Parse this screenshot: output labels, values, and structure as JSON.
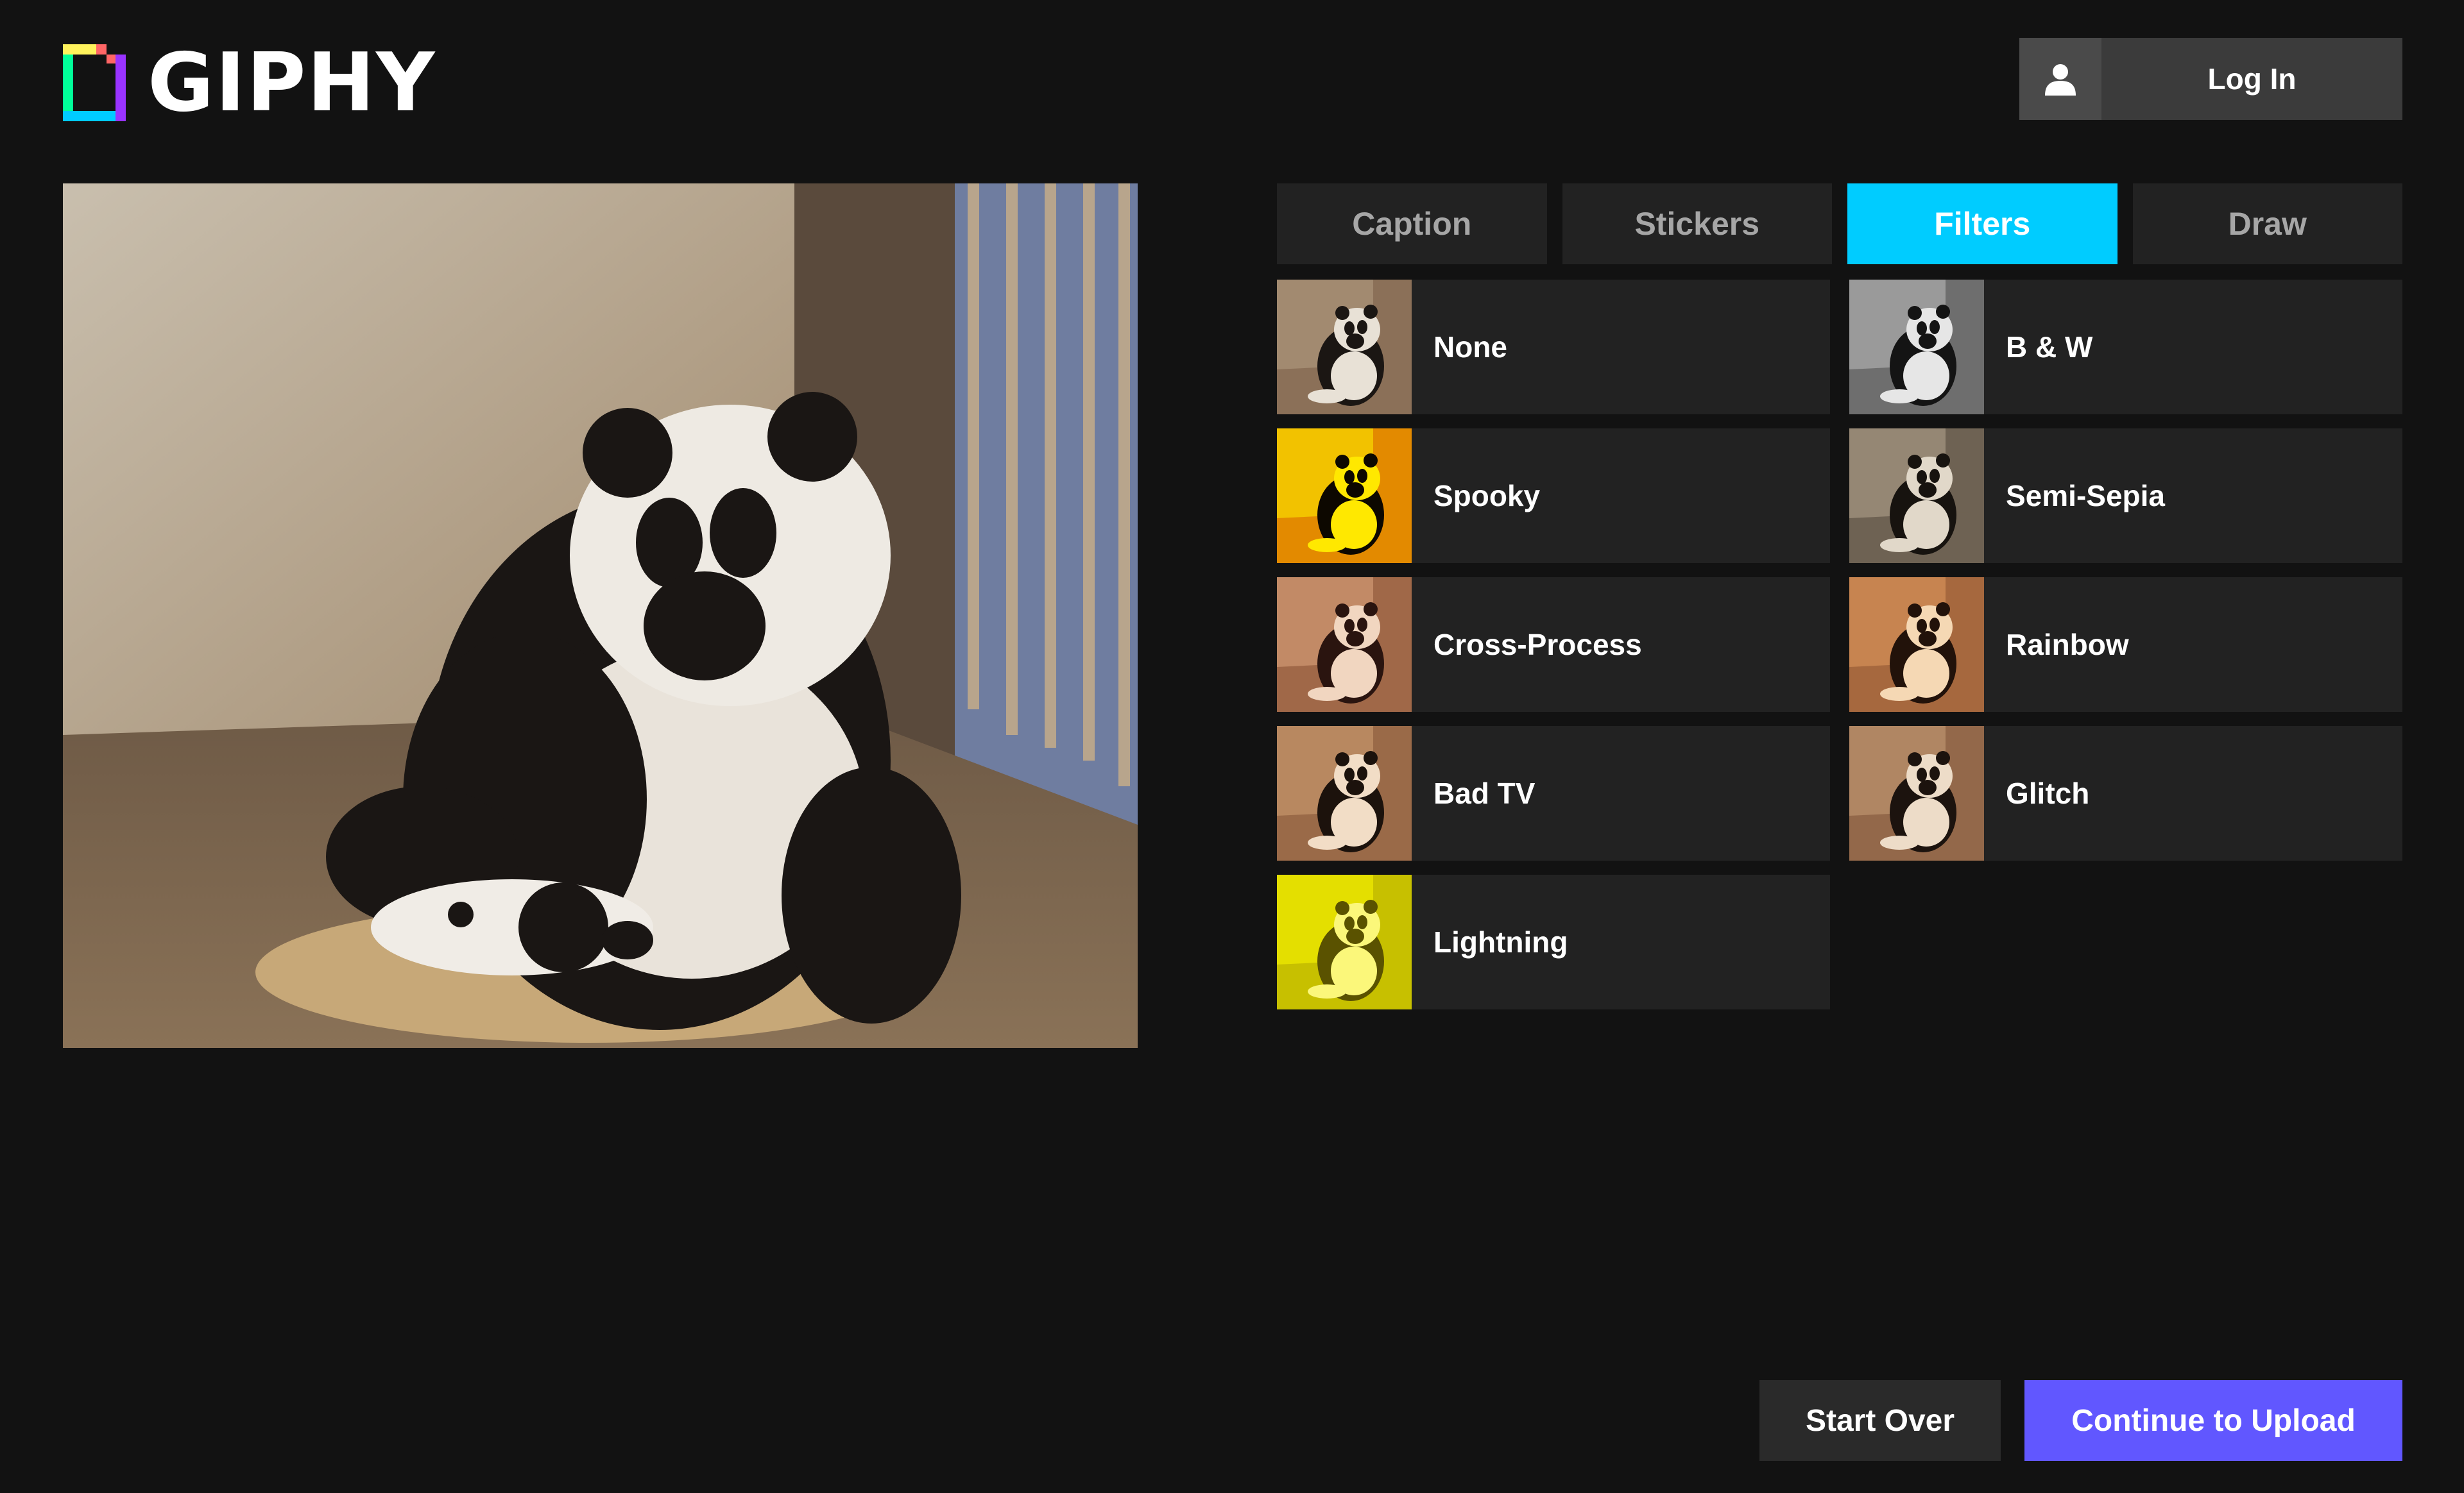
{
  "header": {
    "logo_text": "GIPHY",
    "logo_icon": "giphy-logo-icon",
    "login_label": "Log In",
    "login_icon": "user-icon"
  },
  "preview": {
    "image": "panda-sneeze-gif"
  },
  "tabs": [
    {
      "label": "Caption",
      "active": false
    },
    {
      "label": "Stickers",
      "active": false
    },
    {
      "label": "Filters",
      "active": true
    },
    {
      "label": "Draw",
      "active": false
    }
  ],
  "filters": [
    {
      "label": "None",
      "tint": "none"
    },
    {
      "label": "B & W",
      "tint": "bw"
    },
    {
      "label": "Spooky",
      "tint": "spooky"
    },
    {
      "label": "Semi-Sepia",
      "tint": "semi-sepia"
    },
    {
      "label": "Cross-Process",
      "tint": "cross-process"
    },
    {
      "label": "Rainbow",
      "tint": "rainbow"
    },
    {
      "label": "Bad TV",
      "tint": "bad-tv"
    },
    {
      "label": "Glitch",
      "tint": "glitch"
    },
    {
      "label": "Lightning",
      "tint": "lightning"
    }
  ],
  "footer": {
    "start_over_label": "Start Over",
    "continue_label": "Continue to Upload"
  },
  "colors": {
    "background": "#121212",
    "active_tab": "#00ccff",
    "primary_button": "#6157ff",
    "tile": "#222222"
  }
}
